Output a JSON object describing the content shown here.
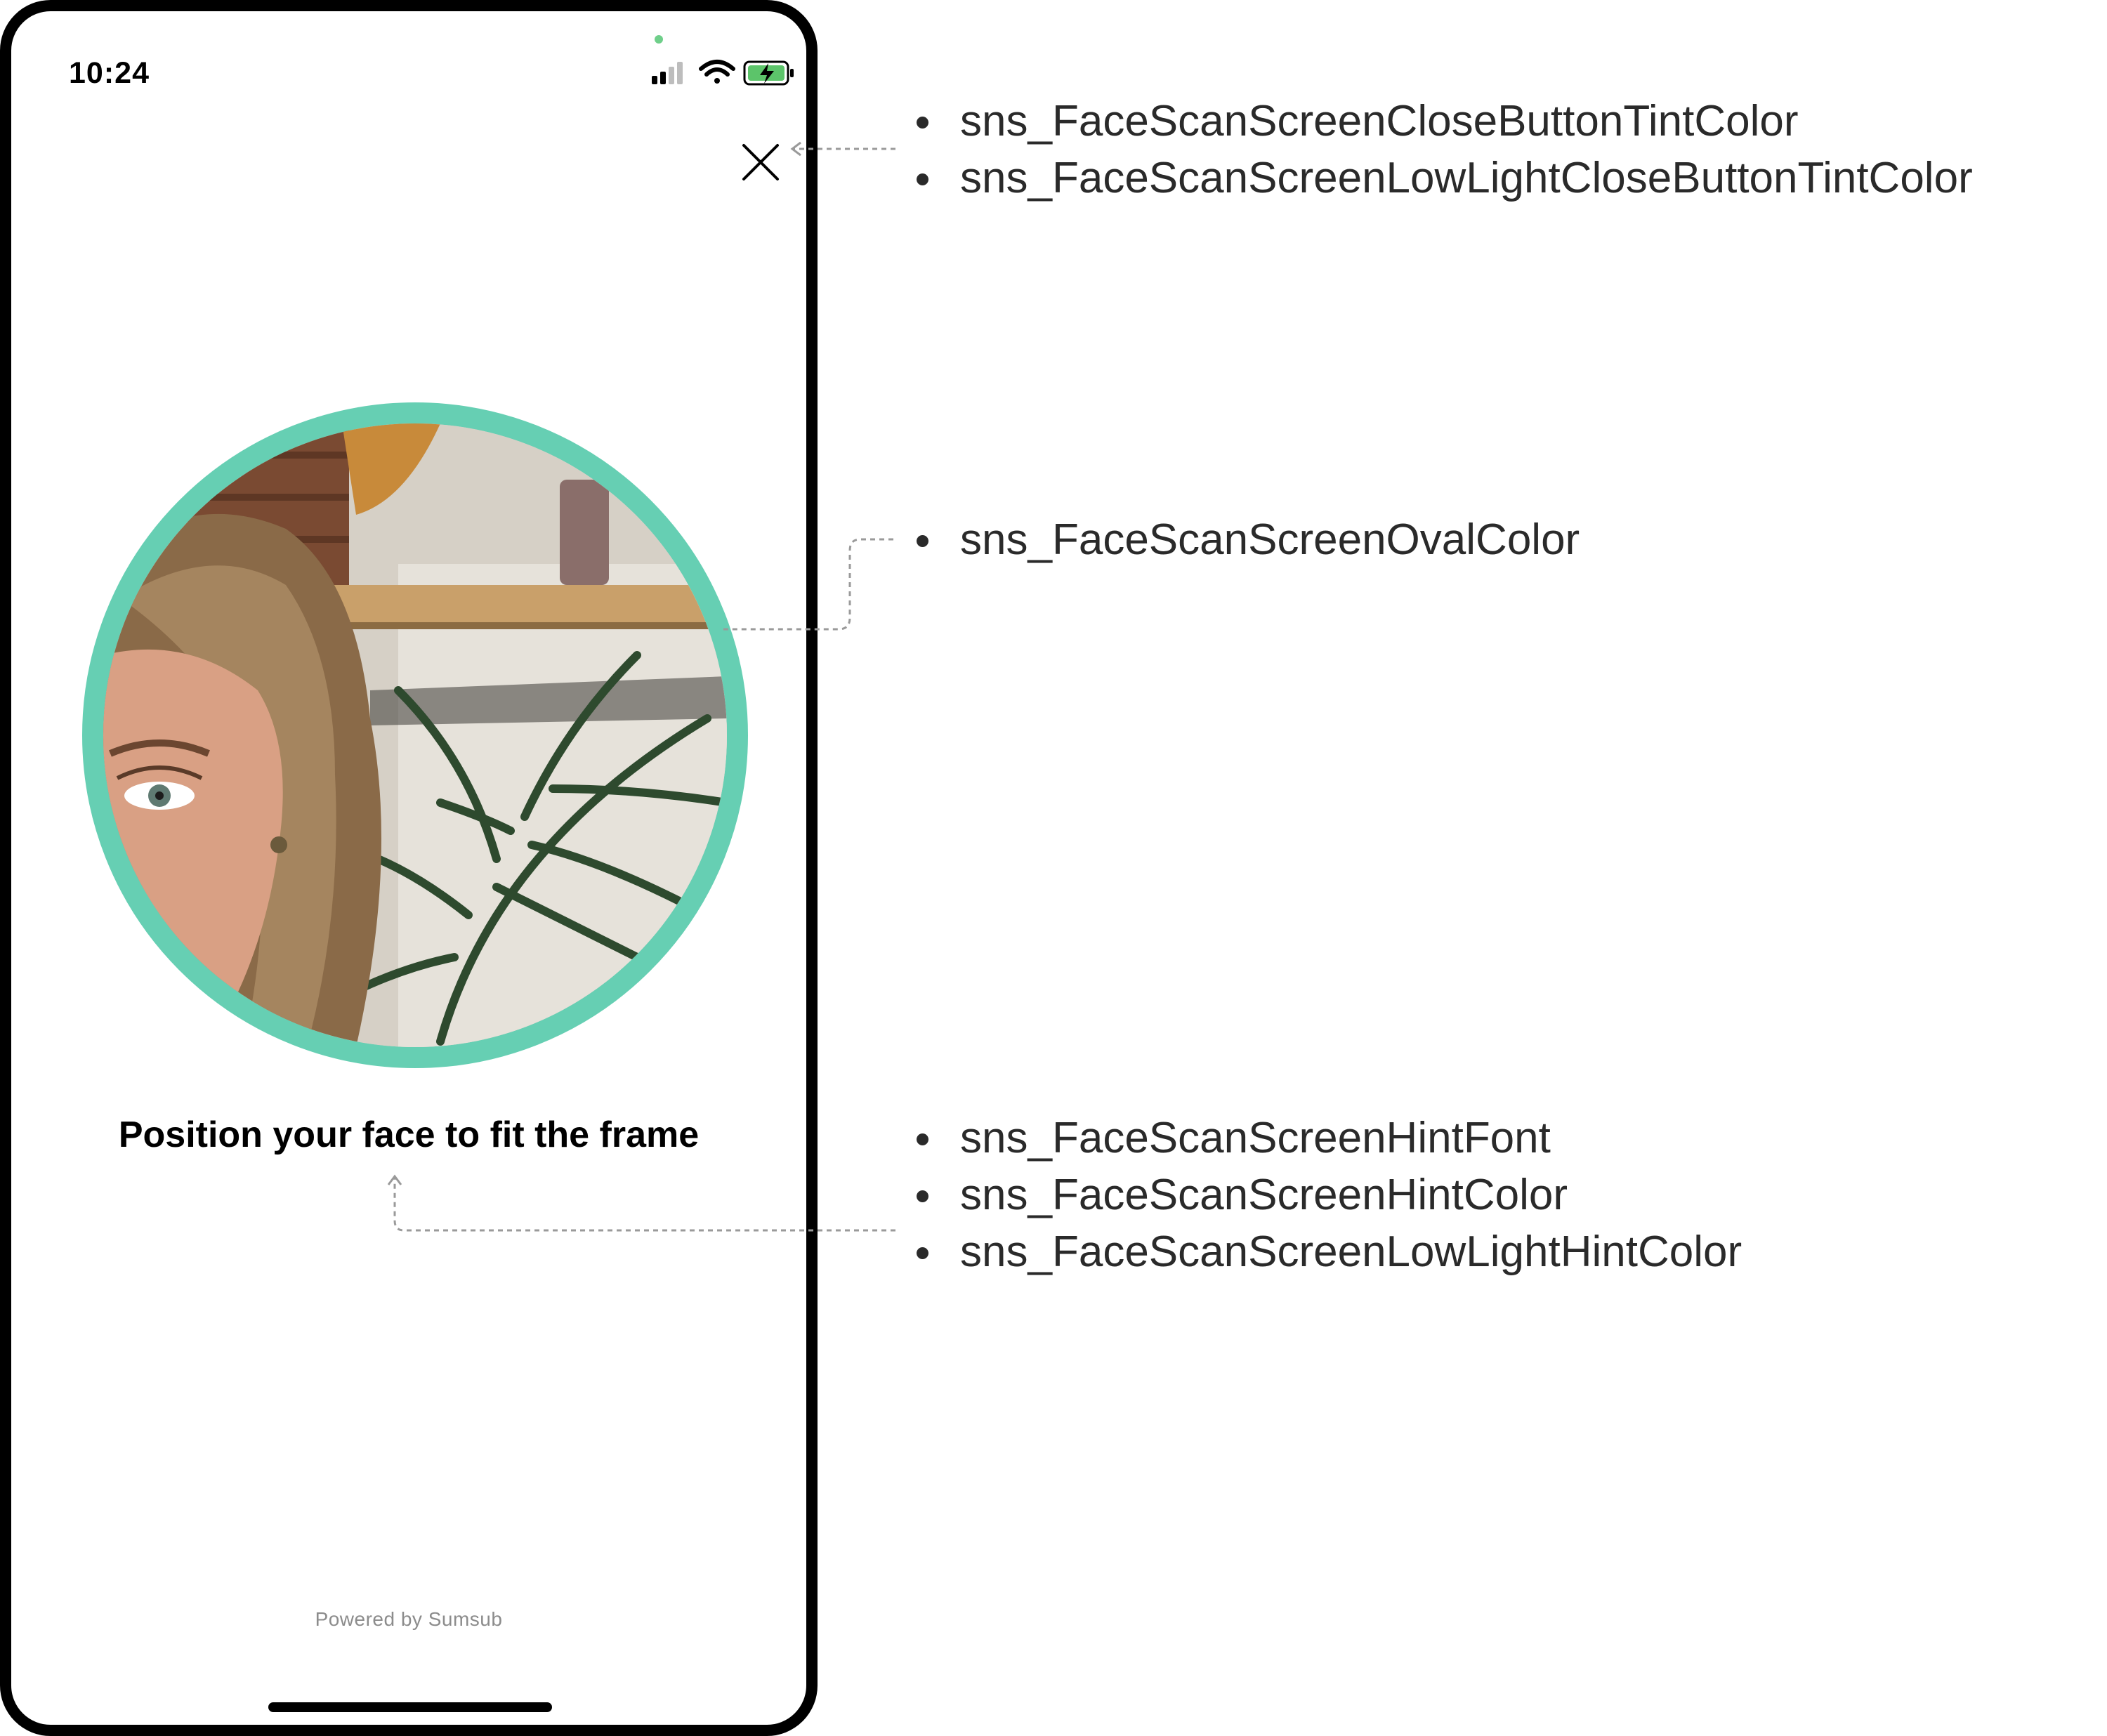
{
  "status_bar": {
    "time": "10:24",
    "icons": [
      "cellular-signal-icon",
      "wifi-icon",
      "battery-charging-icon"
    ]
  },
  "close_button": {
    "icon": "close-icon"
  },
  "face_scan": {
    "oval_color": "#66cfb3",
    "hint": "Position your face to fit the frame"
  },
  "footer": {
    "powered_by": "Powered by Sumsub"
  },
  "annotations": {
    "close_button": [
      "sns_FaceScanScreenCloseButtonTintColor",
      "sns_FaceScanScreenLowLightCloseButtonTintColor"
    ],
    "oval": [
      "sns_FaceScanScreenOvalColor"
    ],
    "hint": [
      "sns_FaceScanScreenHintFont",
      "sns_FaceScanScreenHintColor",
      "sns_FaceScanScreenLowLightHintColor"
    ]
  }
}
